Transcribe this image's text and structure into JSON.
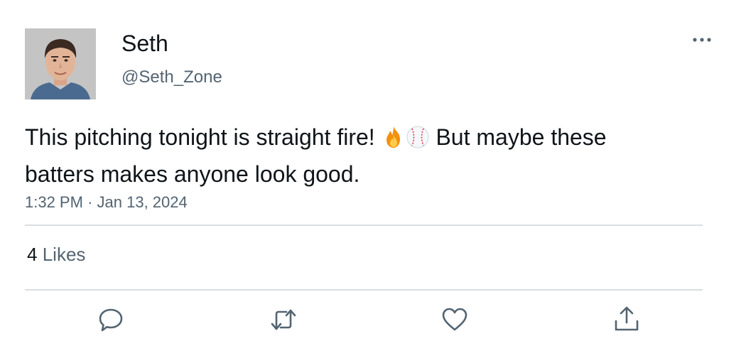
{
  "author": {
    "display_name": "Seth",
    "handle": "@Seth_Zone"
  },
  "tweet": {
    "text_before_emoji": "This pitching tonight is straight fire! ",
    "emojis": [
      "fire-emoji",
      "baseball-emoji"
    ],
    "text_after_emoji": " But maybe these batters makes anyone look good.",
    "time": "1:32 PM",
    "separator": "·",
    "date": "Jan 13, 2024"
  },
  "stats": {
    "likes_count": "4",
    "likes_label": "Likes"
  },
  "actions": [
    "reply-icon",
    "retweet-icon",
    "like-icon",
    "share-icon"
  ],
  "menu_icon": "more-icon",
  "colors": {
    "text": "#0f1419",
    "secondary": "#536471",
    "divider": "#dadee2"
  }
}
